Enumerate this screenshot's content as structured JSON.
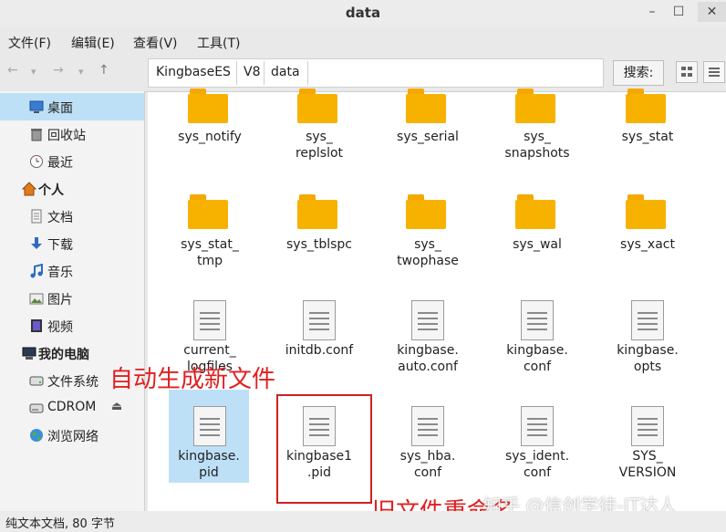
{
  "window": {
    "title": "data",
    "min": "–",
    "max": "☐",
    "close": "✕"
  },
  "menu": [
    {
      "label": "文件(F)"
    },
    {
      "label": "编辑(E)"
    },
    {
      "label": "查看(V)"
    },
    {
      "label": "工具(T)"
    }
  ],
  "nav": {
    "back": "←",
    "back_drop": "▾",
    "forward": "→",
    "fwd_drop": "▾",
    "up": "↑"
  },
  "breadcrumb": [
    "KingbaseES",
    "V8",
    "data"
  ],
  "search": {
    "label": "搜索:"
  },
  "sidebar": {
    "items": [
      {
        "label": "桌面",
        "icon": "desktop-icon"
      },
      {
        "label": "回收站",
        "icon": "trash-icon"
      },
      {
        "label": "最近",
        "icon": "clock-icon"
      },
      {
        "label": "个人",
        "icon": "home-icon"
      },
      {
        "label": "文档",
        "icon": "document-icon"
      },
      {
        "label": "下载",
        "icon": "download-icon"
      },
      {
        "label": "音乐",
        "icon": "music-icon"
      },
      {
        "label": "图片",
        "icon": "picture-icon"
      },
      {
        "label": "视频",
        "icon": "video-icon"
      },
      {
        "label": "我的电脑",
        "icon": "computer-icon"
      },
      {
        "label": "文件系统",
        "icon": "drive-icon"
      },
      {
        "label": "CDROM",
        "icon": "cdrom-icon",
        "eject": "⏏"
      },
      {
        "label": "浏览网络",
        "icon": "globe-icon"
      }
    ]
  },
  "files": [
    {
      "line1": "sys_notify",
      "line2": "",
      "type": "folder"
    },
    {
      "line1": "sys_",
      "line2": "replslot",
      "type": "folder"
    },
    {
      "line1": "sys_serial",
      "line2": "",
      "type": "folder"
    },
    {
      "line1": "sys_",
      "line2": "snapshots",
      "type": "folder"
    },
    {
      "line1": "sys_stat",
      "line2": "",
      "type": "folder"
    },
    {
      "line1": "sys_stat_",
      "line2": "tmp",
      "type": "folder"
    },
    {
      "line1": "sys_tblspc",
      "line2": "",
      "type": "folder"
    },
    {
      "line1": "sys_",
      "line2": "twophase",
      "type": "folder"
    },
    {
      "line1": "sys_wal",
      "line2": "",
      "type": "folder"
    },
    {
      "line1": "sys_xact",
      "line2": "",
      "type": "folder"
    },
    {
      "line1": "current_",
      "line2": "logfiles",
      "type": "file"
    },
    {
      "line1": "initdb.conf",
      "line2": "",
      "type": "file"
    },
    {
      "line1": "kingbase.",
      "line2": "auto.conf",
      "type": "file"
    },
    {
      "line1": "kingbase.",
      "line2": "conf",
      "type": "file"
    },
    {
      "line1": "kingbase.",
      "line2": "opts",
      "type": "file"
    },
    {
      "line1": "kingbase.",
      "line2": "pid",
      "type": "file"
    },
    {
      "line1": "kingbase1",
      "line2": ".pid",
      "type": "file"
    },
    {
      "line1": "sys_hba.",
      "line2": "conf",
      "type": "file"
    },
    {
      "line1": "sys_ident.",
      "line2": "conf",
      "type": "file"
    },
    {
      "line1": "SYS_",
      "line2": "VERSION",
      "type": "file"
    }
  ],
  "status": "纯文本文档, 80 字节",
  "annotations": {
    "new_file": "自动生成新文件",
    "old_file": "旧文件重命名"
  },
  "watermark": "知乎 @信创学徒-IT达人",
  "colors": {
    "accent": "#bde0f7",
    "folder": "#f7b200",
    "annotation": "#e02020"
  }
}
